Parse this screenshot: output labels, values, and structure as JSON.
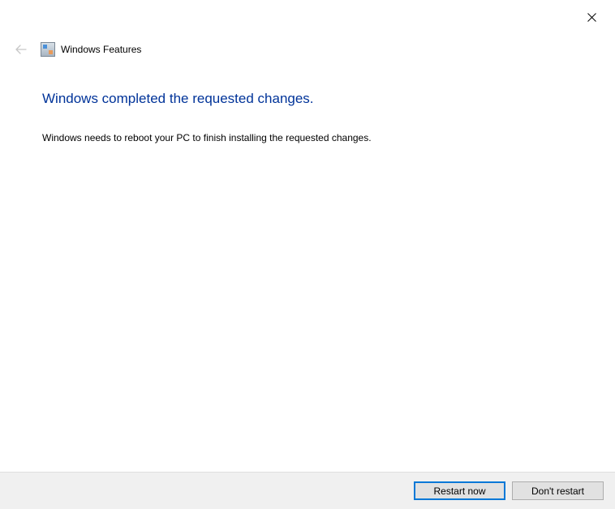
{
  "window": {
    "title": "Windows Features"
  },
  "main": {
    "heading": "Windows completed the requested changes.",
    "body": "Windows needs to reboot your PC to finish installing the requested changes."
  },
  "footer": {
    "restart_now_label": "Restart now",
    "dont_restart_label": "Don't restart"
  }
}
